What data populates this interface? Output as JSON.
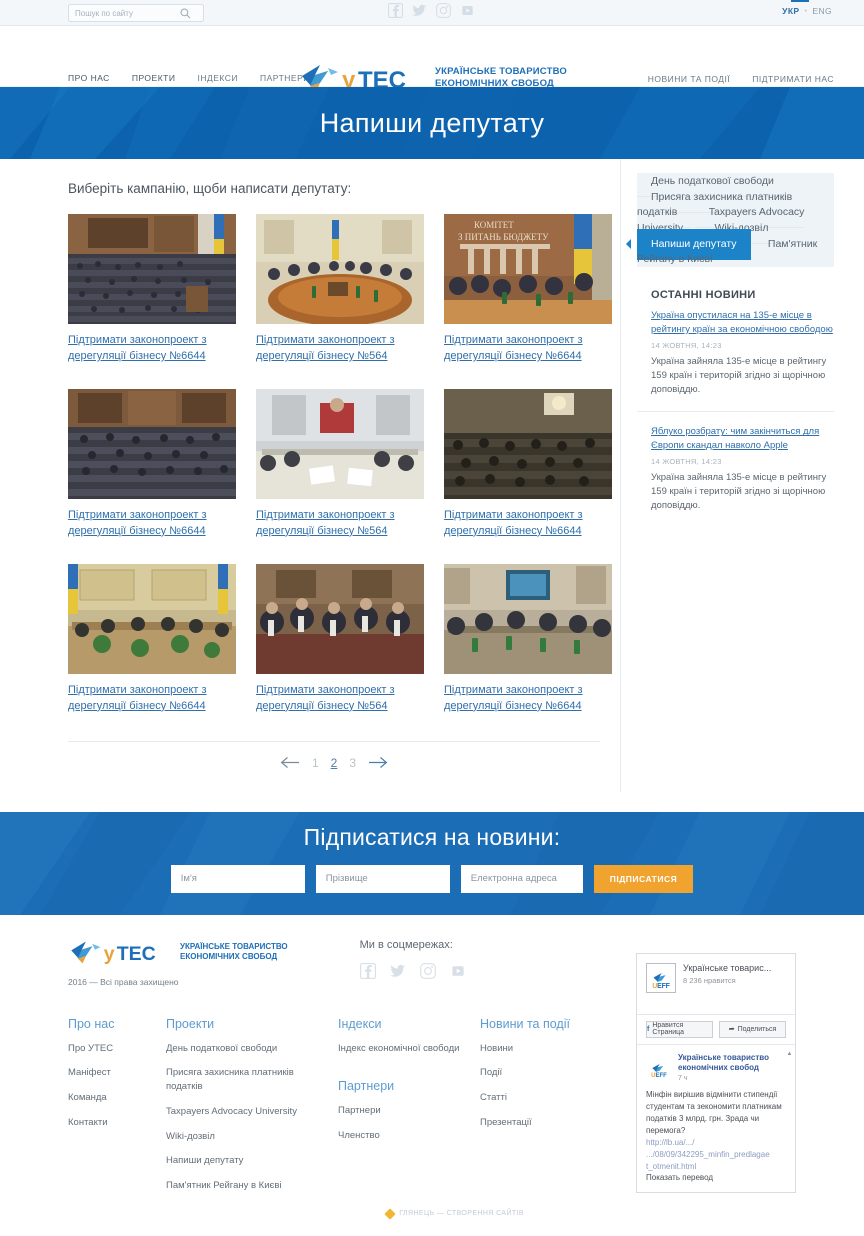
{
  "topbar": {
    "search_placeholder": "Пошук по сайту",
    "search_value": "",
    "social": [
      {
        "name": "facebook-icon",
        "label": "Facebook"
      },
      {
        "name": "twitter-icon",
        "label": "Twitter"
      },
      {
        "name": "instagram-icon",
        "label": "Instagram"
      },
      {
        "name": "youtube-icon",
        "label": "YouTube"
      }
    ],
    "lang_ukr": "УКР",
    "lang_sep": "•",
    "lang_eng": "ENG"
  },
  "header": {
    "nav_left": [
      {
        "label": "ПРО НАС",
        "active": false
      },
      {
        "label": "ПРОЕКТИ",
        "active": true
      },
      {
        "label": "ІНДЕКСИ",
        "active": false
      },
      {
        "label": "ПАРТНЕРИ",
        "active": false
      }
    ],
    "nav_right": [
      {
        "label": "НОВИНИ ТА ПОДІЇ",
        "active": false
      },
      {
        "label": "ПІДТРИМАТИ НАС",
        "active": false
      }
    ],
    "logo_word": "УТЕС",
    "logo_line1": "УКРАЇНСЬКЕ ТОВАРИСТВО",
    "logo_line2": "ЕКОНОМІЧНИХ СВОБОД",
    "accent_color": "#e8a33d",
    "brand_color": "#1d6fb8"
  },
  "banner": {
    "title": "Напиши депутату",
    "background": "#0c62ad"
  },
  "main": {
    "section_title": "Виберіть кампанію, щоби написати депутату:",
    "cards": [
      {
        "caption": "Підтримати законопроект з дерегуляції бізнесу №6644",
        "image": "rada-session-hall"
      },
      {
        "caption": "Підтримати законопроект з дерегуляції бізнесу №564",
        "image": "committee-round-table"
      },
      {
        "caption": "Підтримати законопроект з дерегуляції бізнесу №6644",
        "image": "budget-committee-meeting"
      },
      {
        "caption": "Підтримати законопроект з дерегуляції бізнесу №6644",
        "image": "parliament-plenary"
      },
      {
        "caption": "Підтримати законопроект з дерегуляції бізнесу №564",
        "image": "press-briefing-room"
      },
      {
        "caption": "Підтримати законопроект з дерегуляції бізнесу №6644",
        "image": "conference-audience"
      },
      {
        "caption": "Підтримати законопроект з дерегуляції бізнесу №6644",
        "image": "green-hall-table"
      },
      {
        "caption": "Підтримати законопроект з дерегуляції бізнесу №564",
        "image": "speaker-panel"
      },
      {
        "caption": "Підтримати законопроект з дерегуляції бізнесу №6644",
        "image": "round-table-screen"
      }
    ],
    "pagination": {
      "prev_icon": "arrow-left-icon",
      "next_icon": "arrow-right-icon",
      "pages": [
        {
          "label": "1",
          "active": false
        },
        {
          "label": "2",
          "active": true
        },
        {
          "label": "3",
          "active": false
        }
      ]
    }
  },
  "aside": {
    "menu": [
      {
        "label": "День податкової свободи",
        "active": false
      },
      {
        "label": "Присяга захисника платників податків",
        "active": false
      },
      {
        "label": "Taxpayers Advocacy University",
        "active": false
      },
      {
        "label": "Wiki-дозвіл",
        "active": false
      },
      {
        "label": "Напиши депутату",
        "active": true
      },
      {
        "label": "Пам'ятник Рейгану в Києві",
        "active": false
      }
    ],
    "news_heading": "ОСТАННІ НОВИНИ",
    "news": [
      {
        "title": "Україна опустилася на 135-е місце в рейтингу країн за економічною свободою",
        "date": "14 ЖОВТНЯ, 14:23",
        "text": "Україна зайняла 135-е місце в рейтингу 159 країн і територій згідно зі щорічною доповіддю."
      },
      {
        "title": "Яблуко розбрату: чим закінчиться для Європи скандал навколо Apple",
        "date": "14 ЖОВТНЯ, 14:23",
        "text": "Україна зайняла 135-е місце в рейтингу 159 країн і територій згідно зі щорічною доповіддю."
      }
    ]
  },
  "subscribe": {
    "title": "Підписатися на новини:",
    "first_name_placeholder": "Ім'я",
    "last_name_placeholder": "Прізвище",
    "email_placeholder": "Електронна адреса",
    "button_label": "ПІДПИСАТИСЯ",
    "button_color": "#f0a32e",
    "background": "#1b6db5"
  },
  "footer": {
    "logo_word": "УТЕС",
    "logo_line1": "УКРАЇНСЬКЕ ТОВАРИСТВО",
    "logo_line2": "ЕКОНОМІЧНИХ СВОБОД",
    "copyright": "2016 —  Всі права захищено",
    "social_label": "Ми в соцмережах:",
    "columns": [
      {
        "heading": "Про нас",
        "links": [
          "Про УТЕС",
          "Маніфест",
          "Команда",
          "Контакти"
        ]
      },
      {
        "heading": "Проекти",
        "links": [
          "День податкової свободи",
          "Присяга захисника платників податків",
          "Taxpayers Advocacy University",
          "Wiki-дозвіл",
          "Напиши депутату",
          "Пам'ятник Рейгану в Києві"
        ]
      },
      {
        "heading": "Індекси",
        "links": [
          "Індекс економічної свободи"
        ],
        "heading2": "Партнери",
        "links2": [
          "Партнери",
          "Членство"
        ]
      },
      {
        "heading": "Новини та події",
        "links": [
          "Новини",
          "Події",
          "Статті",
          "Презентації"
        ]
      }
    ],
    "credit": "ГЛЯНЕЦЬ — СТВОРЕННЯ САЙТІВ"
  },
  "fb_widget": {
    "page_name": "Українське товарис...",
    "likes": "8 236 нравится",
    "like_button": "Нравится Страница",
    "share_button": "Поделиться",
    "post_author": "Українське товариство економічних свобод",
    "post_time": "7 ч",
    "post_text": "Мінфін вирішив відмінити стипендії студентам та зекономити платникам податків 3 млрд. грн. Зрада чи перемога?",
    "post_link_1": "http://lb.ua/.../",
    "post_link_2": ".../08/09/342295_minfin_predlagae",
    "post_link_3": "t_otmenit.html",
    "translate": "Показать перевод",
    "avatar_text": "UEFF"
  }
}
